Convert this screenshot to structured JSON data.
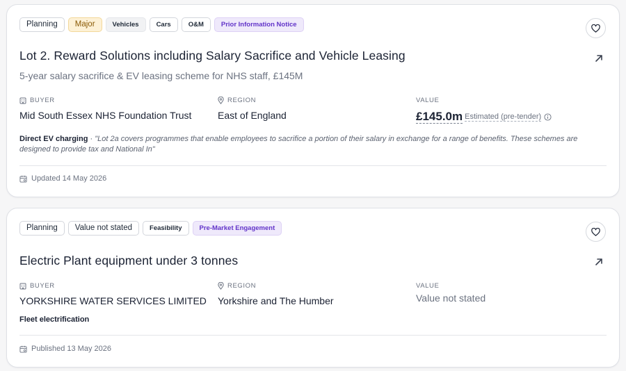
{
  "cards": [
    {
      "tags": [
        "Planning",
        "Major",
        "Vehicles",
        "Cars",
        "O&M",
        "Prior Information Notice"
      ],
      "title": "Lot 2. Reward Solutions including Salary Sacrifice and Vehicle Leasing",
      "subtitle": "5-year salary sacrifice & EV leasing scheme for NHS staff, £145M",
      "buyer_label": "BUYER",
      "buyer": "Mid South Essex NHS Foundation Trust",
      "region_label": "REGION",
      "region": "East of England",
      "value_label": "VALUE",
      "value": "£145.0m",
      "value_note": "Estimated (pre-tender)",
      "context_label": "Direct EV charging",
      "context_sep": " · ",
      "context_quote": "\"Lot 2a covers programmes that enable employees to sacrifice a portion of their salary in exchange for a range of benefits. These schemes are designed to provide tax and National In\"",
      "footer": "Updated 14 May 2026"
    },
    {
      "tags": [
        "Planning",
        "Value not stated",
        "Feasibility",
        "Pre-Market Engagement"
      ],
      "title": "Electric Plant equipment under 3 tonnes",
      "buyer_label": "BUYER",
      "buyer": "YORKSHIRE WATER SERVICES LIMITED",
      "region_label": "REGION",
      "region": "Yorkshire and The Humber",
      "value_label": "VALUE",
      "value": "Value not stated",
      "context_label": "Fleet electrification",
      "footer": "Published 13 May 2026"
    }
  ],
  "icons": {
    "favourite": "heart-icon",
    "open": "arrow-up-right-icon",
    "buyer": "building-icon",
    "region": "map-pin-icon",
    "date": "calendar-icon",
    "info": "info-icon"
  },
  "colors": {
    "major_bg": "#fdf1d6",
    "notice_bg": "#efe9fb",
    "notice_text": "#6234c9"
  }
}
